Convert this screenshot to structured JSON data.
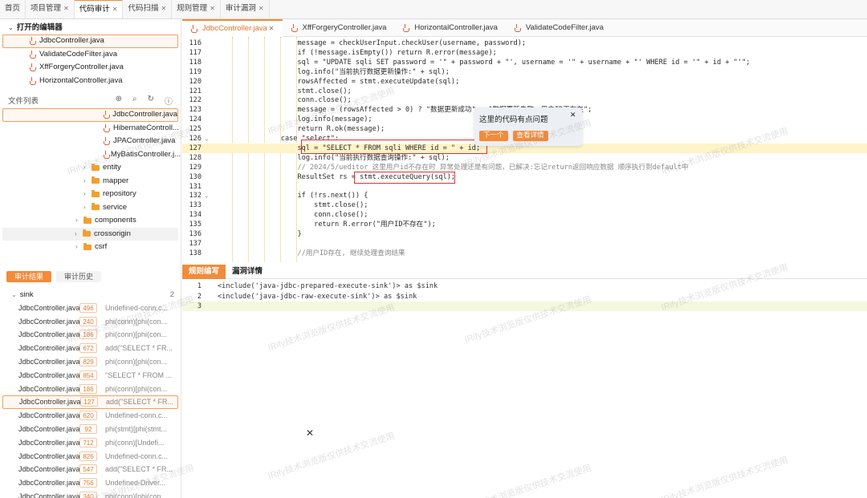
{
  "top_tabs": [
    {
      "label": "首页",
      "closable": false
    },
    {
      "label": "项目管理",
      "closable": true
    },
    {
      "label": "代码审计",
      "closable": true,
      "active": true
    },
    {
      "label": "代码扫描",
      "closable": true
    },
    {
      "label": "规则管理",
      "closable": true
    },
    {
      "label": "审计漏洞",
      "closable": true
    }
  ],
  "open_editors": {
    "title": "打开的编辑器",
    "items": [
      "JdbcController.java",
      "ValidateCodeFilter.java",
      "XffForgeryController.java",
      "HorizontalController.java"
    ]
  },
  "file_list": {
    "title": "文件列表",
    "items": [
      {
        "label": "JdbcController.java",
        "type": "file",
        "selected": true
      },
      {
        "label": "HibernateControll...",
        "type": "file"
      },
      {
        "label": "JPAController.java",
        "type": "file"
      },
      {
        "label": "MyBatisController.j...",
        "type": "file"
      },
      {
        "label": "entity",
        "type": "folder"
      },
      {
        "label": "mapper",
        "type": "folder"
      },
      {
        "label": "repository",
        "type": "folder"
      },
      {
        "label": "service",
        "type": "folder"
      },
      {
        "label": "components",
        "type": "folder"
      },
      {
        "label": "crossorigin",
        "type": "folder",
        "highlight": true
      },
      {
        "label": "csrf",
        "type": "folder"
      }
    ]
  },
  "result_tabs": [
    "审计结果",
    "审计历史"
  ],
  "sink": {
    "label": "sink",
    "count": "2"
  },
  "results": [
    {
      "file": "JdbcController.java",
      "line": "496",
      "desc": "Undefined-conn.c..."
    },
    {
      "file": "JdbcController.java",
      "line": "240",
      "desc": "phi(conn)[phi(con..."
    },
    {
      "file": "JdbcController.java",
      "line": "186",
      "desc": "phi(conn)[phi(con..."
    },
    {
      "file": "JdbcController.java",
      "line": "672",
      "desc": "add(\"SELECT * FR..."
    },
    {
      "file": "JdbcController.java",
      "line": "829",
      "desc": "phi(conn)[phi(con..."
    },
    {
      "file": "JdbcController.java",
      "line": "854",
      "desc": "\"SELECT * FROM ..."
    },
    {
      "file": "JdbcController.java",
      "line": "186",
      "desc": "phi(conn)[phi(con..."
    },
    {
      "file": "JdbcController.java",
      "line": "127",
      "desc": "add(\"SELECT * FR...",
      "selected": true
    },
    {
      "file": "JdbcController.java",
      "line": "620",
      "desc": "Undefined-conn.c..."
    },
    {
      "file": "JdbcController.java",
      "line": "92",
      "desc": "phi(stmt)[phi(stmt..."
    },
    {
      "file": "JdbcController.java",
      "line": "712",
      "desc": "phi(conn)[Undefi..."
    },
    {
      "file": "JdbcController.java",
      "line": "826",
      "desc": "Undefined-conn.c..."
    },
    {
      "file": "JdbcController.java",
      "line": "547",
      "desc": "add(\"SELECT * FR..."
    },
    {
      "file": "JdbcController.java",
      "line": "756",
      "desc": "Undefined-Driver..."
    },
    {
      "file": "JdbcController.java",
      "line": "340",
      "desc": "phi(conn)[phi(con..."
    }
  ],
  "editor_tabs": [
    {
      "label": "JdbcController.java",
      "active": true,
      "closable": true
    },
    {
      "label": "XffForgeryController.java"
    },
    {
      "label": "HorizontalController.java"
    },
    {
      "label": "ValidateCodeFilter.java"
    }
  ],
  "code_lines": [
    {
      "n": "116",
      "t": "                    message = checkUserInput.checkUser(username, password);"
    },
    {
      "n": "117",
      "t": "                    if (!message.isEmpty()) return R.error(message);"
    },
    {
      "n": "118",
      "t": "                    sql = \"UPDATE sqli SET password = '\" + password + \"', username = '\" + username + \"' WHERE id = '\" + id + \"'\";"
    },
    {
      "n": "119",
      "t": "                    log.info(\"当前执行数据更新操作:\" + sql);"
    },
    {
      "n": "120",
      "t": "                    rowsAffected = stmt.executeUpdate(sql);"
    },
    {
      "n": "121",
      "t": "                    stmt.close();"
    },
    {
      "n": "122",
      "t": "                    conn.close();"
    },
    {
      "n": "123",
      "t": "                    message = (rowsAffected > 0) ? \"数据更新成功\" : \"数据更新失败，用户ID不存在\";"
    },
    {
      "n": "124",
      "t": "                    log.info(message);"
    },
    {
      "n": "125",
      "t": "                    return R.ok(message);"
    },
    {
      "n": "126",
      "t": "                case \"select\":",
      "fold": "v"
    },
    {
      "n": "127",
      "t": "                    sql = \"SELECT * FROM sqli WHERE id = \" + id;",
      "hl": true
    },
    {
      "n": "128",
      "t": "                    log.info(\"当前执行数据查询操作:\" + sql);"
    },
    {
      "n": "129",
      "t": "                    // 2024/5/ueditor 这里用户id不存在时 异常处理还是有问题，已解决:忘记return返回响应数据 顺序执行到default中",
      "cm": true
    },
    {
      "n": "130",
      "t": "                    ResultSet rs = stmt.executeQuery(sql);"
    },
    {
      "n": "131",
      "t": ""
    },
    {
      "n": "132",
      "t": "                    if (!rs.next()) {",
      "fold": "v"
    },
    {
      "n": "133",
      "t": "                        stmt.close();"
    },
    {
      "n": "134",
      "t": "                        conn.close();"
    },
    {
      "n": "135",
      "t": "                        return R.error(\"用户ID不存在\");"
    },
    {
      "n": "136",
      "t": "                    }"
    },
    {
      "n": "137",
      "t": ""
    },
    {
      "n": "138",
      "t": "                    //用户ID存在, 继续处理查询结果",
      "cm": true
    }
  ],
  "popup": {
    "text": "这里的代码有点问题",
    "close": "✕",
    "next": "下一个",
    "detail": "查看详情"
  },
  "bottom_tabs": [
    "规则编写",
    "漏洞详情"
  ],
  "rule_lines": [
    {
      "n": "1",
      "t": "<include('java-jdbc-prepared-execute-sink')> as $sink"
    },
    {
      "n": "2",
      "t": "<include('java-jdbc-raw-execute-sink')> as $sink"
    },
    {
      "n": "3",
      "t": "",
      "hl": true
    }
  ],
  "watermark": "IRify技术浏览版仅供技术交流使用",
  "floating_close": "✕"
}
